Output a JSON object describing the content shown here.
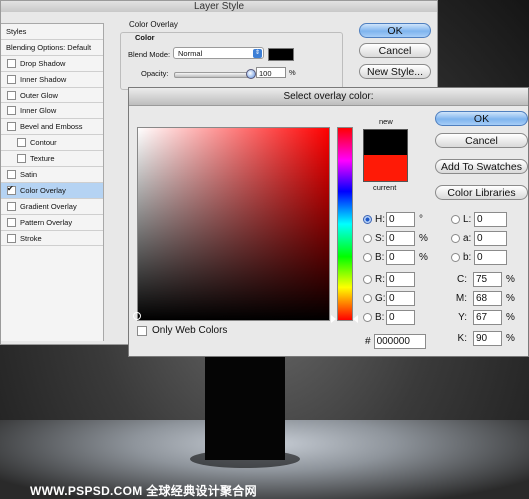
{
  "layer_style": {
    "title": "Layer Style",
    "list": [
      {
        "label": "Styles",
        "type": "header",
        "checked": false
      },
      {
        "label": "Blending Options: Default",
        "type": "header",
        "checked": false
      },
      {
        "label": "Drop Shadow",
        "type": "item",
        "checked": false
      },
      {
        "label": "Inner Shadow",
        "type": "item",
        "checked": false
      },
      {
        "label": "Outer Glow",
        "type": "item",
        "checked": false
      },
      {
        "label": "Inner Glow",
        "type": "item",
        "checked": false
      },
      {
        "label": "Bevel and Emboss",
        "type": "item",
        "checked": false
      },
      {
        "label": "Contour",
        "type": "sub",
        "checked": false
      },
      {
        "label": "Texture",
        "type": "sub",
        "checked": false
      },
      {
        "label": "Satin",
        "type": "item",
        "checked": false
      },
      {
        "label": "Color Overlay",
        "type": "item",
        "checked": true,
        "selected": true
      },
      {
        "label": "Gradient Overlay",
        "type": "item",
        "checked": false
      },
      {
        "label": "Pattern Overlay",
        "type": "item",
        "checked": false
      },
      {
        "label": "Stroke",
        "type": "item",
        "checked": false
      }
    ],
    "panel_title": "Color Overlay",
    "group_title": "Color",
    "blend_mode_label": "Blend Mode:",
    "blend_mode_value": "Normal",
    "opacity_label": "Opacity:",
    "opacity_value": "100",
    "opacity_unit": "%",
    "overlay_color": "#000000",
    "buttons": {
      "ok": "OK",
      "cancel": "Cancel",
      "new_style": "New Style..."
    }
  },
  "picker": {
    "title": "Select overlay color:",
    "new_label": "new",
    "current_label": "current",
    "new_color": "#000000",
    "current_color": "#ff1a06",
    "buttons": {
      "ok": "OK",
      "cancel": "Cancel",
      "add_swatches": "Add To Swatches",
      "color_libraries": "Color Libraries"
    },
    "hsb": [
      {
        "label": "H:",
        "value": "0",
        "unit": "°",
        "selected": true
      },
      {
        "label": "S:",
        "value": "0",
        "unit": "%",
        "selected": false
      },
      {
        "label": "B:",
        "value": "0",
        "unit": "%",
        "selected": false
      }
    ],
    "rgb": [
      {
        "label": "R:",
        "value": "0"
      },
      {
        "label": "G:",
        "value": "0"
      },
      {
        "label": "B:",
        "value": "0"
      }
    ],
    "lab": [
      {
        "label": "L:",
        "value": "0"
      },
      {
        "label": "a:",
        "value": "0"
      },
      {
        "label": "b:",
        "value": "0"
      }
    ],
    "cmyk": [
      {
        "label": "C:",
        "value": "75",
        "unit": "%"
      },
      {
        "label": "M:",
        "value": "68",
        "unit": "%"
      },
      {
        "label": "Y:",
        "value": "67",
        "unit": "%"
      },
      {
        "label": "K:",
        "value": "90",
        "unit": "%"
      }
    ],
    "hex_label": "#",
    "hex_value": "000000",
    "web_colors_label": "Only Web Colors"
  },
  "watermark": "WWW.PSPSD.COM 全球经典设计聚合网"
}
